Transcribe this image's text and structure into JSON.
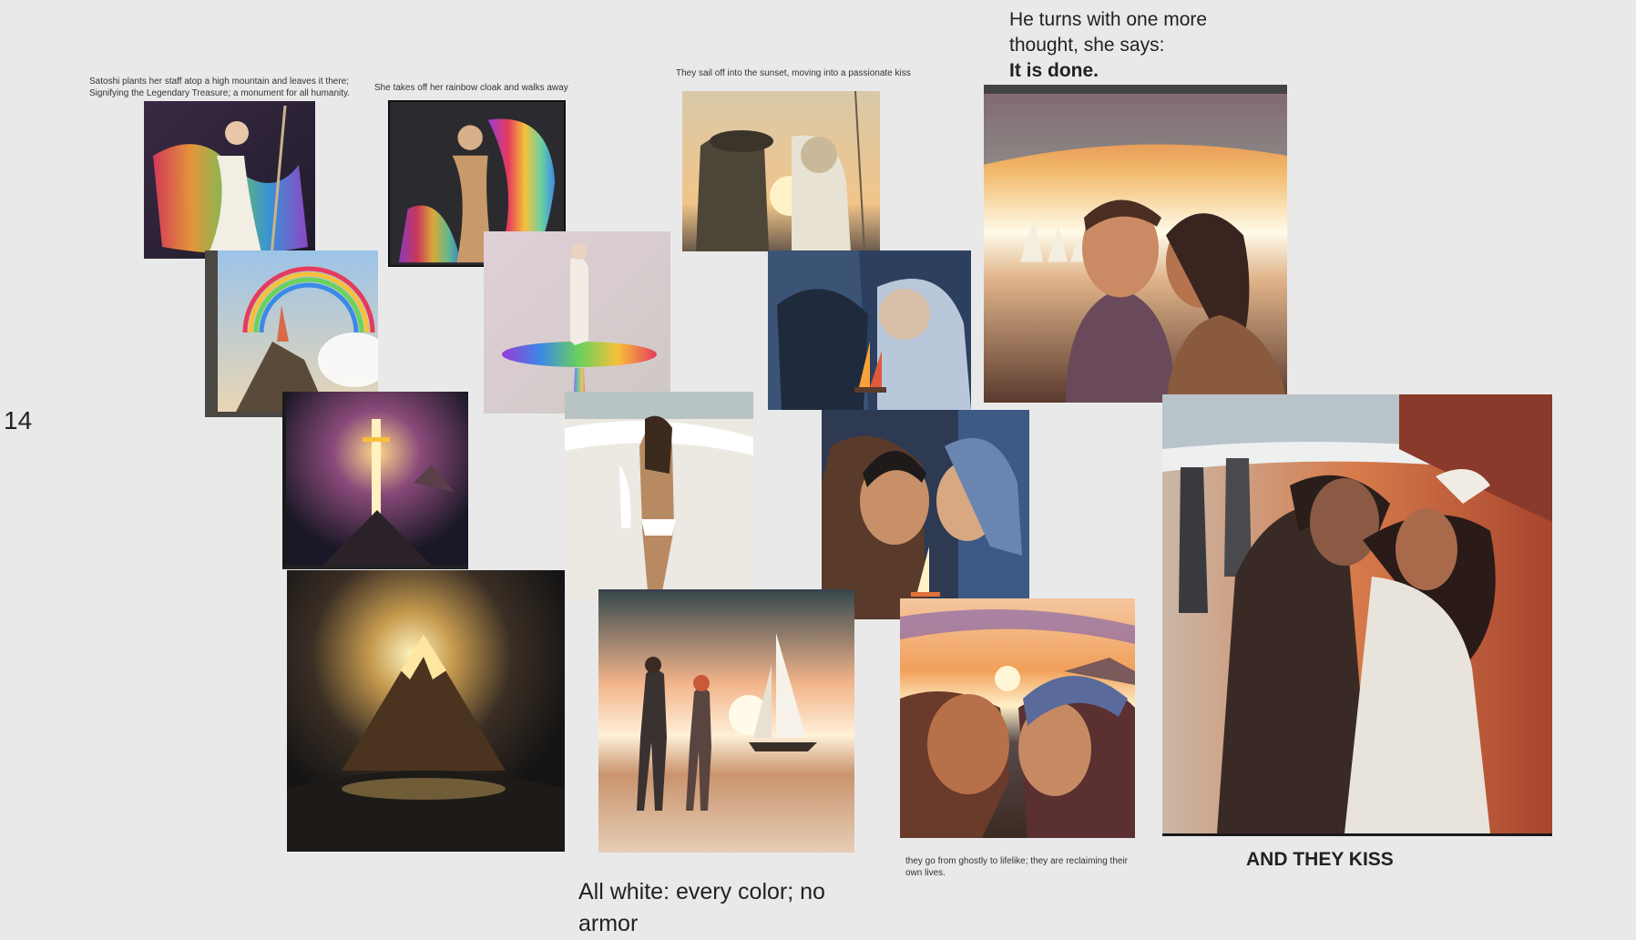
{
  "page_number": "14",
  "captions": {
    "staff": "Satoshi plants her staff atop a high mountain and leaves it there; Signifying the Legendary Treasure; a monument for all humanity.",
    "cloak": "She takes off her rainbow cloak and walks away",
    "sail": "They sail off into the sunset, moving into a passionate kiss",
    "turns_line1": "He turns with one more",
    "turns_line2": "thought, she says:",
    "done": "It is done.",
    "ghostly": "they go from ghostly to lifelike; they are reclaiming their own lives.",
    "kiss": "AND THEY KISS",
    "white": "All white: every color; no armor"
  },
  "colors": {
    "background": "#e9e9ea",
    "text": "#222222"
  }
}
